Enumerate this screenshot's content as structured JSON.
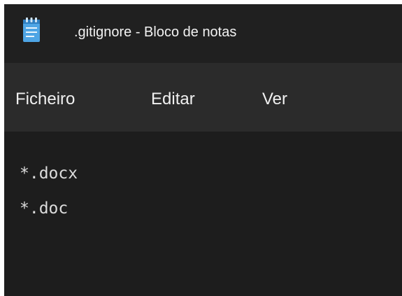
{
  "window": {
    "title": ".gitignore - Bloco de notas",
    "app_icon": "notepad-icon"
  },
  "menubar": {
    "items": [
      {
        "label": "Ficheiro"
      },
      {
        "label": "Editar"
      },
      {
        "label": "Ver"
      }
    ]
  },
  "editor": {
    "lines": [
      "*.docx",
      "*.doc"
    ]
  },
  "colors": {
    "titlebar_bg": "#202020",
    "menubar_bg": "#2b2b2b",
    "editor_bg": "#1d1d1d",
    "icon_accent": "#4ea5e5"
  }
}
